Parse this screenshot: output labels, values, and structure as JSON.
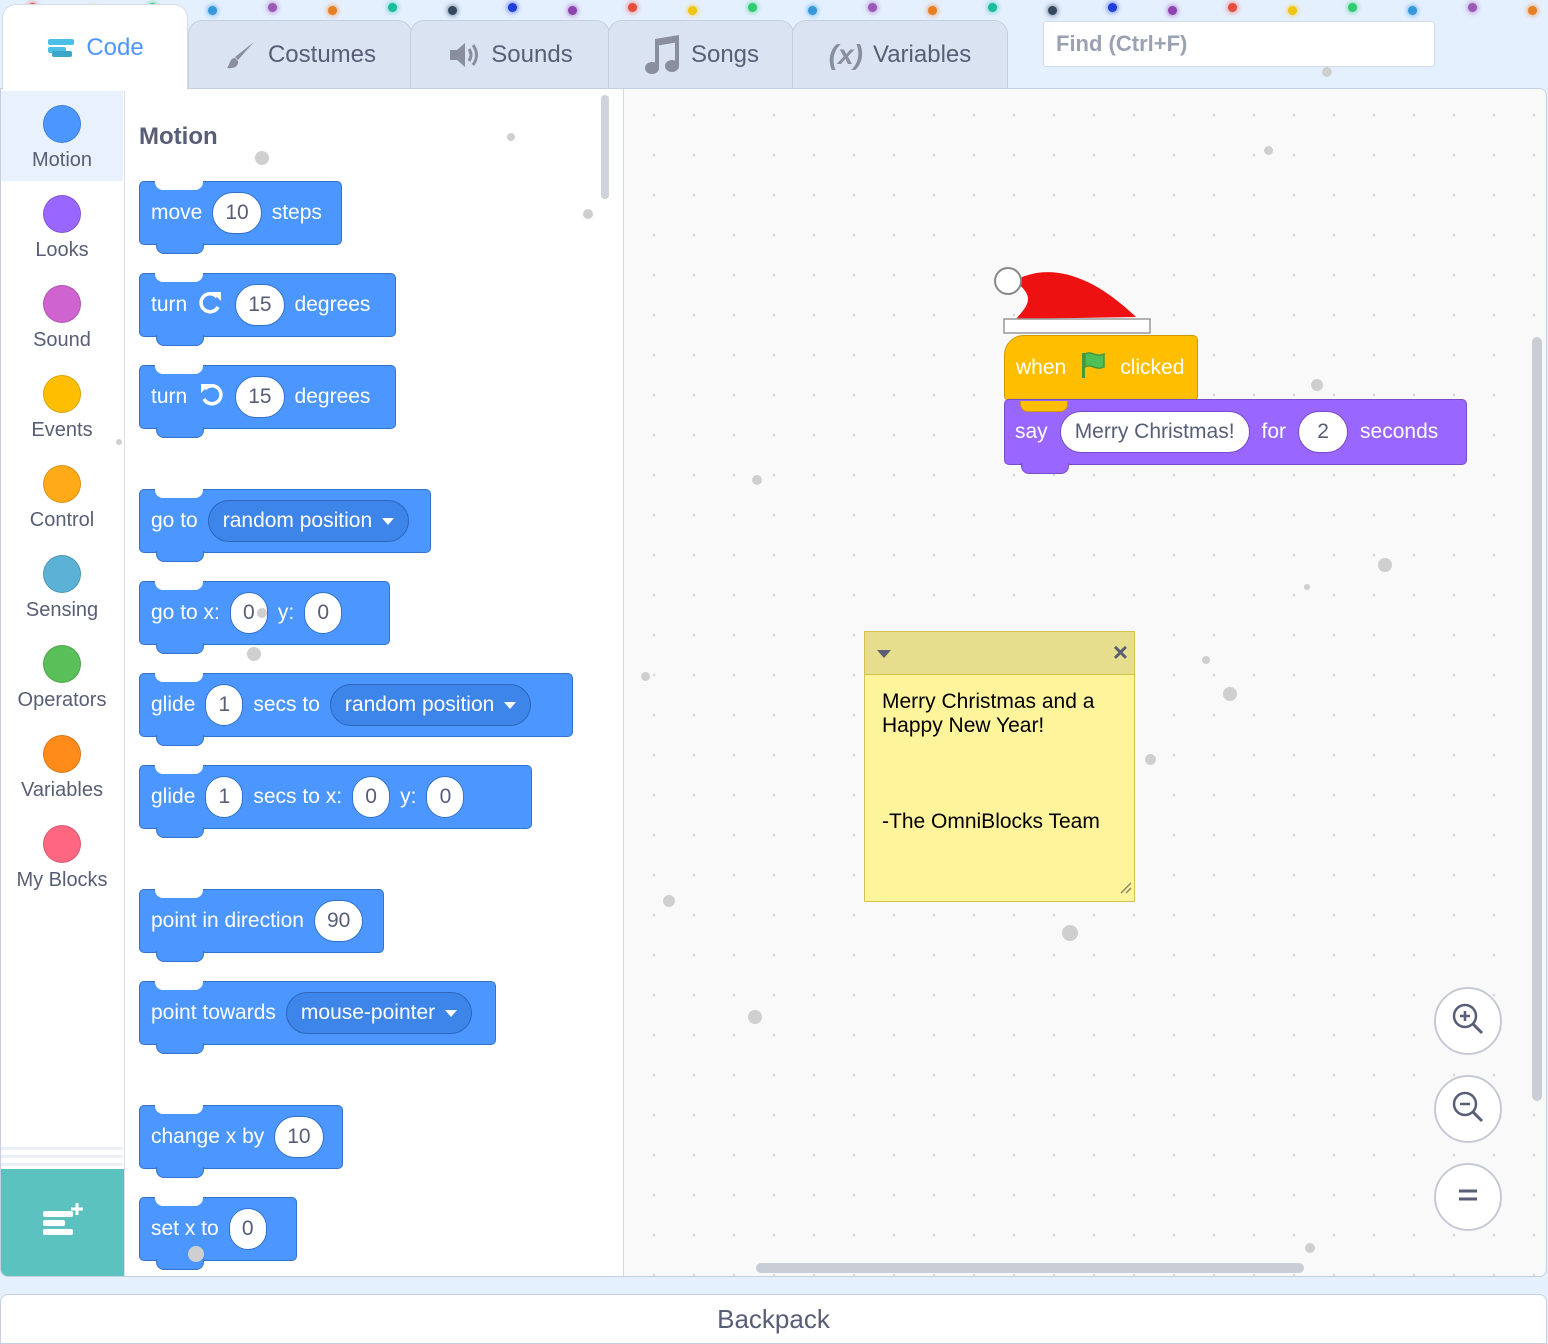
{
  "tabs": {
    "code": "Code",
    "costumes": "Costumes",
    "sounds": "Sounds",
    "songs": "Songs",
    "variables": "Variables"
  },
  "search": {
    "placeholder": "Find (Ctrl+F)"
  },
  "categories": [
    {
      "label": "Motion",
      "color": "#4c97ff"
    },
    {
      "label": "Looks",
      "color": "#9966ff"
    },
    {
      "label": "Sound",
      "color": "#cf63cf"
    },
    {
      "label": "Events",
      "color": "#ffbf00"
    },
    {
      "label": "Control",
      "color": "#ffab19"
    },
    {
      "label": "Sensing",
      "color": "#5cb1d6"
    },
    {
      "label": "Operators",
      "color": "#59c059"
    },
    {
      "label": "Variables",
      "color": "#ff8c1a"
    },
    {
      "label": "My Blocks",
      "color": "#ff6680"
    }
  ],
  "palette": {
    "title": "Motion",
    "move": {
      "a": "move",
      "v": "10",
      "b": "steps"
    },
    "turn_right": {
      "a": "turn",
      "v": "15",
      "b": "degrees"
    },
    "turn_left": {
      "a": "turn",
      "v": "15",
      "b": "degrees"
    },
    "goto": {
      "a": "go to",
      "menu": "random position"
    },
    "gotoxy": {
      "a": "go to x:",
      "x": "0",
      "b": "y:",
      "y": "0"
    },
    "glide": {
      "a": "glide",
      "v": "1",
      "b": "secs to",
      "menu": "random position"
    },
    "glidexy": {
      "a": "glide",
      "v": "1",
      "b": "secs to x:",
      "x": "0",
      "c": "y:",
      "y": "0"
    },
    "point_dir": {
      "a": "point in direction",
      "v": "90"
    },
    "point_towards": {
      "a": "point towards",
      "menu": "mouse-pointer"
    },
    "change_x": {
      "a": "change x by",
      "v": "10"
    },
    "set_x": {
      "a": "set x to",
      "v": "0"
    }
  },
  "script": {
    "hat": {
      "a": "when",
      "b": "clicked"
    },
    "say": {
      "a": "say",
      "msg": "Merry Christmas!",
      "b": "for",
      "secs": "2",
      "c": "seconds"
    }
  },
  "note": {
    "text": "Merry Christmas and a\nHappy New Year!\n\n\n\n-The OmniBlocks Team"
  },
  "backpack": "Backpack",
  "colors": {
    "motion": "#4c97ff",
    "events": "#ffbf00",
    "looks": "#9966ff",
    "extension": "#5cc2bf"
  }
}
